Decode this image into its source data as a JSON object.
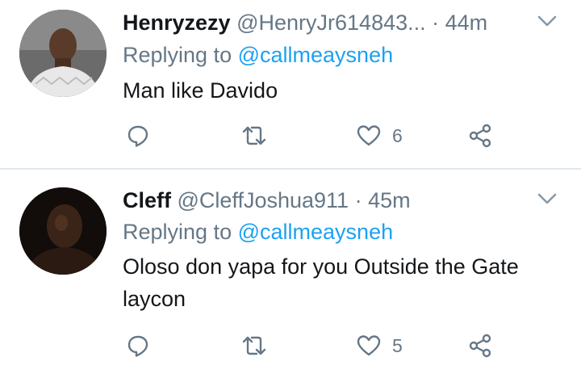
{
  "tweets": [
    {
      "name": "Henryzezy",
      "handle": "@HenryJr614843...",
      "time": "· 44m",
      "replying_prefix": "Replying to",
      "replying_to": "@callmeaysneh",
      "text": "Man like Davido",
      "likes": "6"
    },
    {
      "name": "Cleff",
      "handle": "@CleffJoshua911",
      "time": "· 45m",
      "replying_prefix": "Replying to",
      "replying_to": "@callmeaysneh",
      "text": "Oloso don yapa for you Outside the Gate laycon",
      "likes": "5"
    }
  ],
  "colors": {
    "text": "#14171a",
    "secondary": "#657786",
    "link": "#1da1f2",
    "divider": "#e1e8ed"
  },
  "icons": [
    "reply-icon",
    "retweet-icon",
    "heart-icon",
    "share-icon",
    "chevron-down-icon"
  ]
}
